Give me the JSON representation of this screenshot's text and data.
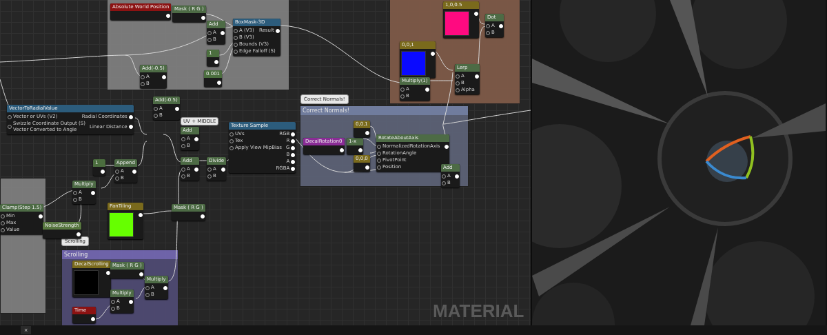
{
  "comments": [
    {
      "kind": "grey"
    },
    {
      "kind": "grey"
    },
    {
      "kind": "brown"
    },
    {
      "kind": "slate",
      "title": "Correct Normals!",
      "bubble": "Correct Normals!"
    },
    {
      "kind": "purple",
      "title": "Scrolling",
      "bubble": "Scrolling"
    }
  ],
  "graph_nodes": [
    {
      "kind": "world",
      "title": "Absolute World Position"
    },
    {
      "kind": "function",
      "title": "Mask ( R G )"
    },
    {
      "kind": "function",
      "title": "Add",
      "inputs": [
        "A",
        "B"
      ]
    },
    {
      "kind": "constant",
      "title": "1"
    },
    {
      "kind": "constant",
      "title": "0.001"
    },
    {
      "kind": "custom",
      "title": "BoxMask-3D",
      "inputs": [
        "A (V3)",
        "B (V3)",
        "Bounds (V3)",
        "Edge Falloff (S)"
      ],
      "outputs": [
        "Result"
      ]
    },
    {
      "kind": "function",
      "title": "Add(-0.5)",
      "inputs": [
        "A",
        "B"
      ]
    },
    {
      "kind": "custom",
      "title": "VectorToRadialValue",
      "inputs": [
        "Vector or UVs (V2)",
        "Swizzle Coordinate Output (S) Vector Converted to Angle"
      ],
      "outputs": [
        "Radial Coordinates",
        "Linear Distance"
      ]
    },
    {
      "kind": "function",
      "title": "Add(-0.5)",
      "inputs": [
        "A",
        "B"
      ]
    },
    {
      "kind": "function",
      "title": "Add",
      "inputs": [
        "A",
        "B"
      ]
    },
    {
      "kind": "constant",
      "title": "1"
    },
    {
      "kind": "function",
      "title": "Append",
      "inputs": [
        "A",
        "B"
      ]
    },
    {
      "kind": "function",
      "title": "Multiply",
      "inputs": [
        "A",
        "B"
      ]
    },
    {
      "kind": "function",
      "title": "Clamp(Step 1.5)",
      "inputs": [
        "Min",
        "Max",
        "Value"
      ]
    },
    {
      "kind": "scalar",
      "title": "NoiseStrength"
    },
    {
      "kind": "param",
      "title": "PanTiling",
      "color": "#66ff00"
    },
    {
      "kind": "function",
      "title": "Add",
      "inputs": [
        "A",
        "B"
      ]
    },
    {
      "kind": "function",
      "title": "Divide",
      "inputs": [
        "A",
        "B"
      ]
    },
    {
      "kind": "function",
      "title": "Mask ( R G )"
    },
    {
      "kind": "custom",
      "title": "Texture Sample",
      "inputs": [
        "UVs",
        "Tex",
        "Apply View MipBias"
      ],
      "outputs": [
        "RGB",
        "R",
        "G",
        "B",
        "A",
        "RGBA"
      ]
    },
    {
      "kind": "param",
      "title": "1,0,0.5",
      "color": "#ff0a80"
    },
    {
      "kind": "function",
      "title": "Dot",
      "inputs": [
        "A",
        "B"
      ]
    },
    {
      "kind": "param",
      "title": "0,0,1",
      "color": "#0a0aff"
    },
    {
      "kind": "function",
      "title": "Multiply(1)",
      "inputs": [
        "A",
        "B"
      ]
    },
    {
      "kind": "function",
      "title": "Lerp",
      "inputs": [
        "A",
        "B",
        "Alpha"
      ]
    },
    {
      "kind": "purple",
      "title": "DecalRotation0"
    },
    {
      "kind": "function",
      "title": "1-x"
    },
    {
      "kind": "param",
      "title": "0,0,1"
    },
    {
      "kind": "param",
      "title": "0,0,0"
    },
    {
      "kind": "function",
      "title": "RotateAboutAxis",
      "inputs": [
        "NormalizedRotationAxis",
        "RotationAngle",
        "PivotPoint",
        "Position"
      ]
    },
    {
      "kind": "function",
      "title": "Add",
      "inputs": [
        "A",
        "B"
      ]
    },
    {
      "kind": "param",
      "title": "DecalScrolling",
      "color": "#000000"
    },
    {
      "kind": "function",
      "title": "Mask ( R G )"
    },
    {
      "kind": "function",
      "title": "Multiply",
      "inputs": [
        "A",
        "B"
      ]
    },
    {
      "kind": "function",
      "title": "Multiply",
      "inputs": [
        "A",
        "B"
      ]
    },
    {
      "kind": "world",
      "title": "Time"
    }
  ],
  "comment_bubble_plain": "UV + MIDDLE",
  "graph_label": "MATERIAL",
  "bottom_tab": {
    "close": "×"
  }
}
